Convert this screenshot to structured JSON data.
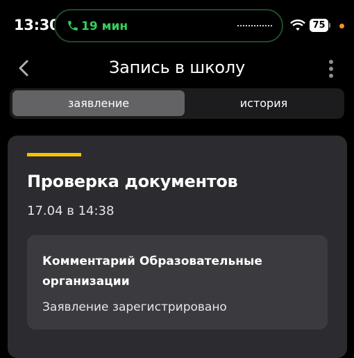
{
  "status_bar": {
    "time": "13:30",
    "call_duration": "19 мин",
    "battery_level": "75",
    "call_color": "#33d05a",
    "privacy_dot_color": "#f0932b"
  },
  "nav": {
    "title": "Запись в школу",
    "back_icon": "chevron-left-icon",
    "more_icon": "more-vertical-icon"
  },
  "tabs": [
    {
      "label": "заявление",
      "active": true
    },
    {
      "label": "история",
      "active": false
    }
  ],
  "status_card": {
    "accent_color": "#f5c400",
    "title": "Проверка документов",
    "date": "17.04 в 14:38",
    "comment": {
      "title": "Комментарий Образовательные организации",
      "text": "Заявление зарегистрировано"
    }
  }
}
